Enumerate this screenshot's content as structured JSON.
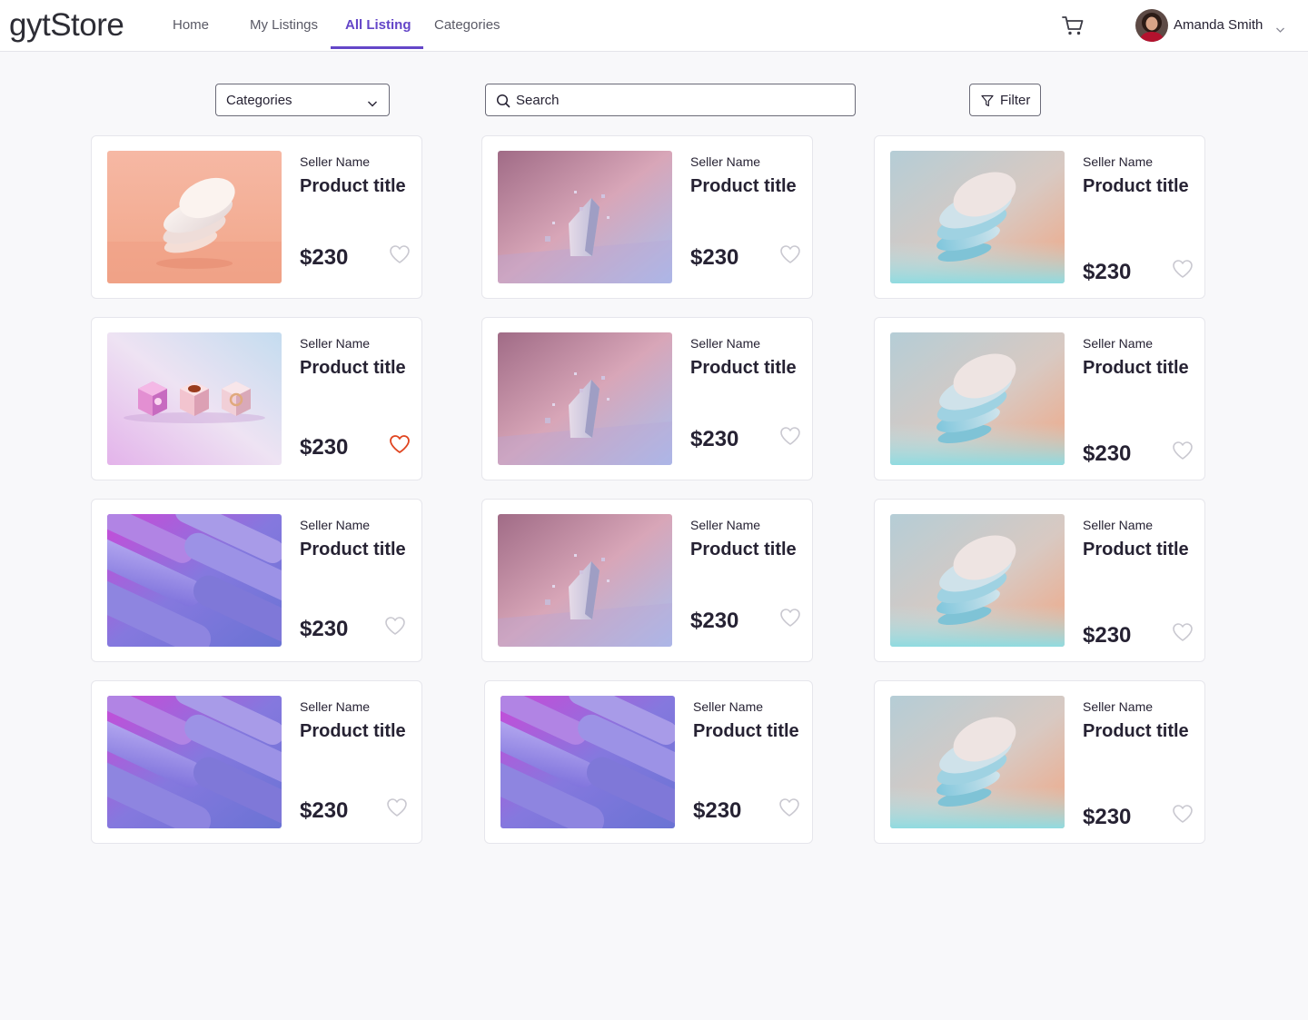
{
  "app": {
    "name": "gytStore"
  },
  "nav": {
    "links": [
      {
        "label": "Home",
        "active": false
      },
      {
        "label": "My Listings",
        "active": false
      },
      {
        "label": "All Listing",
        "active": true
      },
      {
        "label": "Categories",
        "active": false
      }
    ],
    "cart_icon": "shopping-cart-icon",
    "user": {
      "name": "Amanda Smith",
      "menu_icon": "caret-down-icon"
    }
  },
  "toolbar": {
    "categories_select": {
      "value": "Categories",
      "icon": "chevron-down-icon"
    },
    "search": {
      "placeholder": "Search",
      "value": "",
      "icon": "search-icon"
    },
    "filter_button": {
      "label": "Filter",
      "icon": "funnel-icon"
    }
  },
  "colors": {
    "accent": "#6446c8",
    "text": "#262233",
    "heart_inactive": "#c9c8d0",
    "heart_favorited": "#e0441f",
    "page_background": "#f8f8fa"
  },
  "products": [
    {
      "seller": "Seller Name",
      "title": "Product title",
      "price": "$230",
      "image": "peach-disc-stack",
      "favorited": false
    },
    {
      "seller": "Seller Name",
      "title": "Product title",
      "price": "$230",
      "image": "pink-crystal-shard",
      "favorited": false
    },
    {
      "seller": "Seller Name",
      "title": "Product title",
      "price": "$230",
      "image": "teal-disc-stack",
      "favorited": false
    },
    {
      "seller": "Seller Name",
      "title": "Product title",
      "price": "$230",
      "image": "pink-cubes",
      "favorited": true
    },
    {
      "seller": "Seller Name",
      "title": "Product title",
      "price": "$230",
      "image": "pink-crystal-shard",
      "favorited": false
    },
    {
      "seller": "Seller Name",
      "title": "Product title",
      "price": "$230",
      "image": "teal-disc-stack",
      "favorited": false
    },
    {
      "seller": "Seller Name",
      "title": "Product title",
      "price": "$230",
      "image": "purple-pill-shapes",
      "favorited": false
    },
    {
      "seller": "Seller Name",
      "title": "Product title",
      "price": "$230",
      "image": "pink-crystal-shard",
      "favorited": false
    },
    {
      "seller": "Seller Name",
      "title": "Product title",
      "price": "$230",
      "image": "teal-disc-stack",
      "favorited": false
    },
    {
      "seller": "Seller Name",
      "title": "Product title",
      "price": "$230",
      "image": "purple-pill-shapes",
      "favorited": false
    },
    {
      "seller": "Seller Name",
      "title": "Product title",
      "price": "$230",
      "image": "purple-pill-shapes",
      "favorited": false
    },
    {
      "seller": "Seller Name",
      "title": "Product title",
      "price": "$230",
      "image": "teal-disc-stack",
      "favorited": false
    }
  ]
}
